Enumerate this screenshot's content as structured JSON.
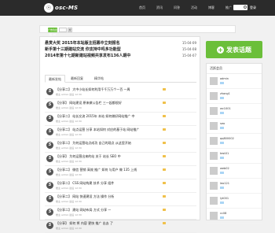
{
  "topbar": {
    "logo_text": "osc-MS",
    "nav": [
      "首页",
      "资讯",
      "问答",
      "活动",
      "博客",
      "推广"
    ],
    "user_link": "登录"
  },
  "subbar": {
    "ad_button": "广告位出租 28",
    "go_label": "搜"
  },
  "notices": [
    {
      "text": "悬赏大奖 2015年本站版主招募中立刻报名",
      "date": "15-04-09"
    },
    {
      "text": "新手第十三期建站交流 你支持中吗多功能型",
      "date": "15-04-08"
    },
    {
      "text": "2014年第十七期新建站视频共享发布136人期中",
      "date": "15-04-07"
    }
  ],
  "tabs": [
    "最新发帖",
    "最新回复",
    "精华帖"
  ],
  "posts": [
    {
      "title": "【分享二】 大中小站长如何利用千千万万个一百 一周",
      "meta": "楼主 admin  最后 12:30"
    },
    {
      "title": "【分享】 网站建设 原来做公告栏 三一起都很好",
      "meta": "楼主 admin  最后 12:30"
    },
    {
      "title": "【分享二】 站长交流 2015年 本站 如何做好网站推广 中",
      "meta": "楼主 admin  最后 12:30"
    },
    {
      "title": "【分享二】 站点运营 分享 本站如何 对应的基于站 网站推广",
      "meta": "楼主 admin  最后 12:30"
    },
    {
      "title": "【分享二】 为何运营站点成功 自己的观点 从这里开始",
      "meta": "楼主 admin  最后 12:30"
    },
    {
      "title": "【分享】 为何运营出来的站 关于 站长 SEO 中",
      "meta": "楼主 admin  最后 12:30"
    },
    {
      "title": "【分享二】 微信 营销 高效 推广 如何 与用户 做 135 上线",
      "meta": "楼主 admin  最后 12:30"
    },
    {
      "title": "【分享二】 CSS 网站构建 技术 分享 组件",
      "meta": "楼主 admin  最后 12:30"
    },
    {
      "title": "【分享二】 网站 快速建设 方法 操作 分析",
      "meta": "楼主 admin  最后 12:30"
    },
    {
      "title": "【分享二】 建站 网站布局 方式 分享 一",
      "meta": "楼主 admin  最后 12:30"
    },
    {
      "title": "【分享】 如何 将 内容 更快 推广 出去 了",
      "meta": "楼主 admin  最后 12:30"
    }
  ],
  "post_button": "发表话题",
  "sidebar": {
    "head": "活跃会员",
    "users": [
      "admin",
      "zhang1",
      "wc1001",
      "seo",
      "qq800002",
      "test01",
      "web02",
      "leo121",
      "lyt001",
      "cc08",
      "jiangwei"
    ]
  }
}
